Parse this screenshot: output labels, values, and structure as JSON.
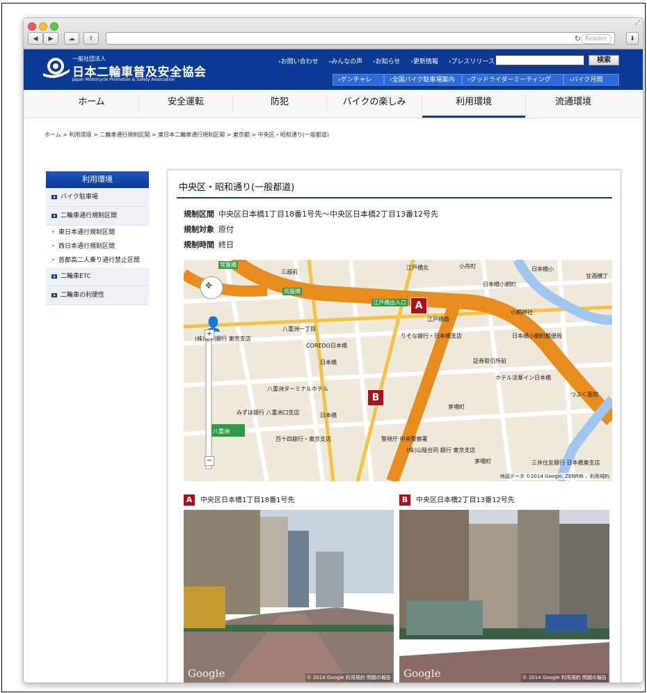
{
  "browser": {
    "reader_label": "Reader"
  },
  "header": {
    "org_type": "一般社団法人",
    "org_name": "日本二輪車普及安全協会",
    "org_name_en": "Japan Motorcycle Promotion & Safety Association",
    "top_links": [
      "お問い合わせ",
      "みんなの声",
      "お知らせ",
      "更新情報",
      "プレスリリース"
    ],
    "search_button": "検索",
    "sub_links": [
      "ゲンチャレ",
      "全国バイク駐車場案内",
      "グッドライダーミーティング",
      "バイク月間"
    ]
  },
  "nav": {
    "items": [
      "ホーム",
      "安全運転",
      "防犯",
      "バイクの楽しみ",
      "利用環境",
      "流通環境"
    ],
    "active": "利用環境"
  },
  "breadcrumb": "ホーム > 利用環境 > 二輪車通行規制区間 > 東日本二輪車通行規制区間 > 東京都 > 中央区・昭和通り(一般都道)",
  "sidebar": {
    "heading": "利用環境",
    "items": [
      "バイク駐車場",
      "二輪車通行規制区間",
      "二輪車ETC",
      "二輪車の利便性"
    ],
    "sub_items": [
      "東日本通行規制区間",
      "西日本通行規制区間",
      "首都高二人乗り通行禁止区間"
    ]
  },
  "main": {
    "title": "中央区・昭和通り(一般都道)",
    "section_label": "規制区間",
    "section_value": "中央区日本橋1丁目18番1号先〜中央区日本橋2丁目13番12号先",
    "target_label": "規制対象",
    "target_value": "原付",
    "time_label": "規制時間",
    "time_value": "終日"
  },
  "map": {
    "pin_a": "A",
    "pin_b": "B",
    "labels": [
      "常盤橋",
      "三越前",
      "江戸橋北",
      "小舟町",
      "日本橋小",
      "甘酒横丁",
      "呉服橋",
      "江戸橋出入口",
      "江戸橋南",
      "日本橋小網町",
      "小網神社",
      "八重洲一丁目",
      "(株)足利銀行 東京支店",
      "COREDO日本橋",
      "りそな銀行・日本橋支店",
      "日本橋小網町郵便局",
      "日本橋",
      "証券取引所前",
      "ホテル法華イン日本橋",
      "八重洲ターミナルホテル",
      "茅場町",
      "つぶく医院",
      "みずほ銀行 八重洲口支店",
      "日本橋",
      "警視庁 中央警察署",
      "八重洲",
      "百十四銀行・東京支店",
      "(株)山陰合同 銀行 東京支店",
      "茅場町",
      "三井住友銀行 日本橋東支店"
    ],
    "credit": "地図データ ©2014 Google, ZENRIN 、利用規約"
  },
  "photos": {
    "a_badge": "A",
    "a_caption": "中央区日本橋1丁目18番1号先",
    "b_badge": "B",
    "b_caption": "中央区日本橋2丁目13番12号先",
    "watermark": "Google",
    "credit": "© 2014 Google 利用規約 問題の報告"
  }
}
